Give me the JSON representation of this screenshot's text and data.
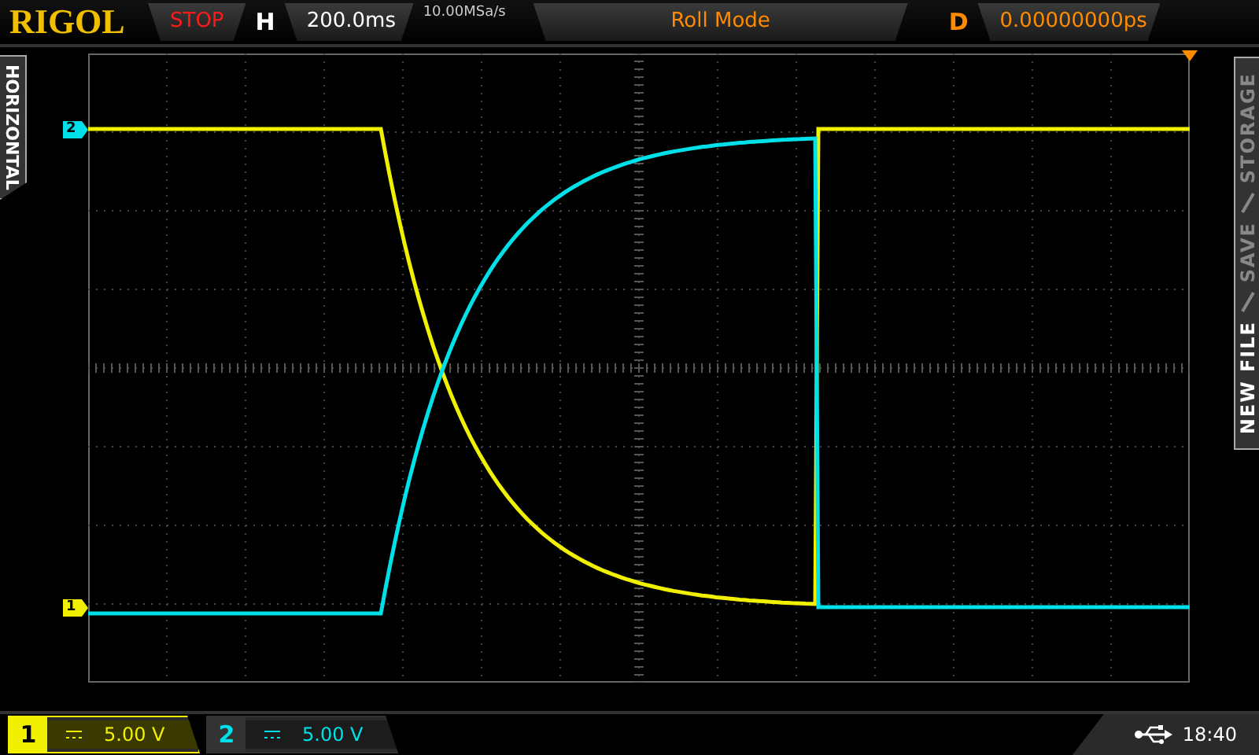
{
  "top_bar": {
    "logo": "RIGOL",
    "run_state": "STOP",
    "horizontal_label": "H",
    "timebase": "200.0ms",
    "sample_rate": "10.00MSa/s",
    "trigger_mode": "Roll Mode",
    "delay_label": "D",
    "delay": "0.00000000ps"
  },
  "left_tab": {
    "label": "HORIZONTAL"
  },
  "channel_markers": [
    {
      "label": "2",
      "color": "#00e0e8"
    },
    {
      "label": "1",
      "color": "#f0f000"
    }
  ],
  "right_menu": [
    {
      "label": "NEW FILE",
      "selected": true
    },
    {
      "label": "SAVE",
      "selected": false
    },
    {
      "label": "STORAGE",
      "selected": false
    }
  ],
  "channels": [
    {
      "number": "1",
      "scale": "5.00 V",
      "selected": true,
      "color": "#f0f000"
    },
    {
      "number": "2",
      "scale": "5.00 V",
      "selected": false,
      "color": "#00e0e8"
    }
  ],
  "status": {
    "time": "18:40"
  }
}
